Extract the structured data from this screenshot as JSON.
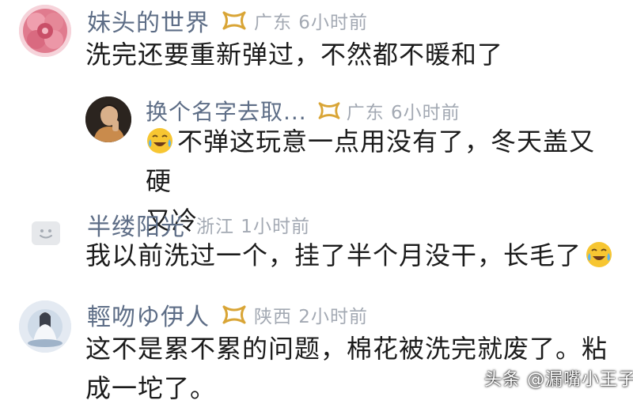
{
  "comments": [
    {
      "name": "妹头的世界",
      "location": "广东 6小时前",
      "text": "洗完还要重新弹过，不然都不暖和了",
      "badge": "gold-vip-badge"
    },
    {
      "name": "换个名字去取...",
      "location": "广东 6小时前",
      "text_line1": "不弹这玩意一点用没有了，冬天盖又硬",
      "text_line2": "又冷",
      "badge": "gold-vip-badge",
      "emoji": "crying-laughing-emoji"
    },
    {
      "name": "半缕阳光",
      "location": "浙江 1小时前",
      "text": "我以前洗过一个，挂了半个月没干，长毛了",
      "emoji": "crying-laughing-emoji"
    },
    {
      "name": "輕吻ゆ伊人",
      "location": "陕西 2小时前",
      "text_line1": "这不是累不累的问题，棉花被洗完就废了。粘",
      "text_line2": "成一坨了。",
      "badge": "gold-vip-badge"
    }
  ],
  "watermark": "头条 @漏嘴小王子",
  "colors": {
    "name": "#5d6d86",
    "location": "#a3a9b3",
    "body_text": "#1b1b1b",
    "badge_gold": "#d9a536"
  }
}
